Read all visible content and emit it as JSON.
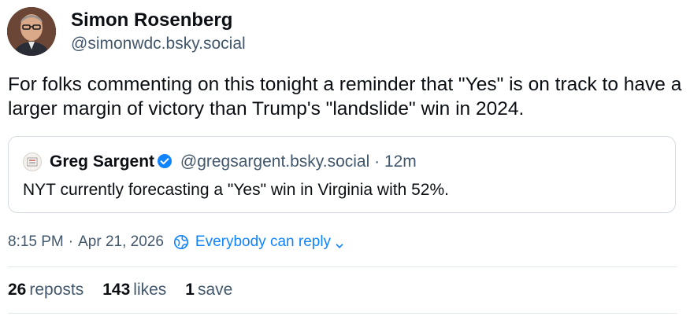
{
  "author": {
    "name": "Simon Rosenberg",
    "handle": "@simonwdc.bsky.social",
    "avatar_icon": "person-photo-avatar"
  },
  "post": {
    "text": "For folks commenting on this tonight a reminder that \"Yes\" is on track to have a larger margin of victory than Trump's \"landslide\" win in 2024."
  },
  "quote": {
    "name": "Greg Sargent",
    "verified_icon": "verified-check-icon",
    "handle": "@gregsargent.bsky.social",
    "dot": "·",
    "time": "12m",
    "text": "NYT currently forecasting a \"Yes\" win in Virginia with 52%.",
    "avatar_icon": "newspaper-avatar"
  },
  "meta": {
    "time": "8:15 PM",
    "sep": "·",
    "date": "Apr 21, 2026",
    "reply_setting": "Everybody can reply",
    "reply_icon": "globe-icon",
    "chevron_icon": "chevron-down-icon"
  },
  "stats": {
    "reposts_count": "26",
    "reposts_label": "reposts",
    "likes_count": "143",
    "likes_label": "likes",
    "saves_count": "1",
    "saves_label": "save"
  },
  "colors": {
    "accent": "#1083fe",
    "muted": "#42576c",
    "text": "#0b0f14",
    "border": "#d4dbe2"
  }
}
